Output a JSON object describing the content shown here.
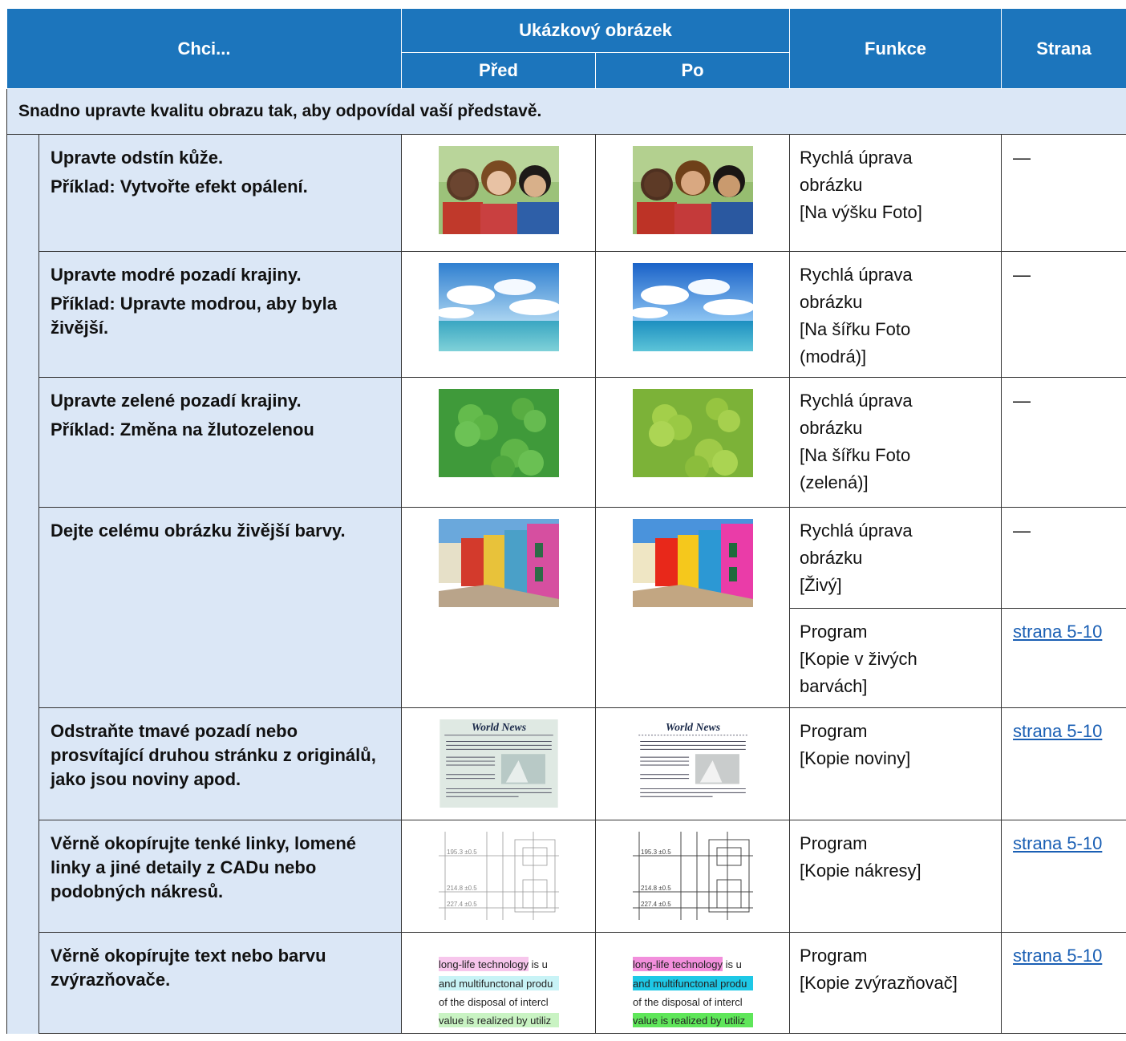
{
  "header": {
    "want": "Chci...",
    "sample": "Ukázkový obrázek",
    "before": "Před",
    "after": "Po",
    "function": "Funkce",
    "page": "Strana"
  },
  "section_title": "Snadno upravte kvalitu obrazu tak, aby odpovídal vaší představě.",
  "rows": [
    {
      "want": "Upravte odstín kůže.",
      "example": "Příklad: Vytvořte efekt opálení.",
      "func_lines": [
        "Rychlá úprava",
        "obrázku",
        "[Na výšku Foto]"
      ],
      "page": "—",
      "image_before": "people-photo-icon",
      "image_after": "people-photo-tanned-icon"
    },
    {
      "want": "Upravte modré pozadí krajiny.",
      "example": "Příklad: Upravte modrou, aby byla živější.",
      "func_lines": [
        "Rychlá úprava",
        "obrázku",
        "[Na šířku Foto",
        "(modrá)]"
      ],
      "page": "—",
      "image_before": "sky-sea-photo-icon",
      "image_after": "sky-sea-vivid-photo-icon"
    },
    {
      "want": "Upravte zelené pozadí krajiny.",
      "example": "Příklad: Změna na žlutozelenou",
      "func_lines": [
        "Rychlá úprava",
        "obrázku",
        "[Na šířku Foto",
        "(zelená)]"
      ],
      "page": "—",
      "image_before": "clover-photo-icon",
      "image_after": "clover-yellowgreen-photo-icon"
    },
    {
      "want": "Dejte celému obrázku živější barvy.",
      "func_lines": [
        "Rychlá úprava",
        "obrázku",
        "[Živý]"
      ],
      "page": "—",
      "func2_lines": [
        "Program",
        "[Kopie v živých",
        "barvách]"
      ],
      "page2": "strana 5-10",
      "image_before": "colorful-houses-photo-icon",
      "image_after": "colorful-houses-vivid-photo-icon"
    },
    {
      "want": "Odstraňte tmavé pozadí nebo prosvítající druhou stránku z originálů, jako jsou noviny apod.",
      "func_lines": [
        "Program",
        "[Kopie noviny]"
      ],
      "page": "strana 5-10",
      "image_before": "newspaper-tinted-icon",
      "image_after": "newspaper-clean-icon",
      "news_headline": "World News"
    },
    {
      "want": "Věrně okopírujte tenké linky, lomené linky a jiné detaily z CADu nebo podobných nákresů.",
      "func_lines": [
        "Program",
        "[Kopie nákresy]"
      ],
      "page": "strana 5-10",
      "image_before": "cad-drawing-icon",
      "image_after": "cad-drawing-sharp-icon"
    },
    {
      "want": "Věrně okopírujte text nebo barvu zvýrazňovače.",
      "func_lines": [
        "Program",
        "[Kopie zvýrazňovač]"
      ],
      "page": "strana 5-10",
      "image_before": "highlighted-text-icon",
      "image_after": "highlighted-text-vivid-icon",
      "highlight_lines": [
        "long-life technology is u",
        "and multifunctonal produ",
        "of the disposal of intercl",
        "value is realized by utiliz"
      ]
    }
  ],
  "colors": {
    "header_bg": "#1c75bc",
    "section_bg": "#dbe7f6",
    "link": "#1a5fb4"
  }
}
